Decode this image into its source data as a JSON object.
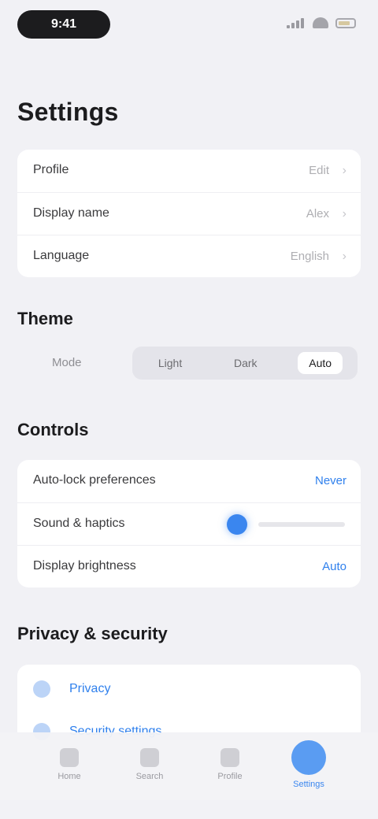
{
  "status_bar": {
    "time": "9:41"
  },
  "page": {
    "title": "Settings"
  },
  "account": {
    "rows": [
      {
        "label": "Profile",
        "value": "Edit"
      },
      {
        "label": "Display name",
        "value": "Alex"
      },
      {
        "label": "Language",
        "value": "English"
      }
    ]
  },
  "theme": {
    "title": "Theme",
    "label": "Mode",
    "options": [
      "Light",
      "Dark",
      "Auto"
    ],
    "selected": "Auto"
  },
  "controls": {
    "title": "Controls",
    "rows": [
      {
        "label": "Auto-lock preferences",
        "value": "Never"
      },
      {
        "label": "Sound & haptics",
        "level": 0.0
      },
      {
        "label": "Display brightness",
        "value": "Auto"
      }
    ]
  },
  "support": {
    "title": "Privacy & security",
    "links": [
      {
        "label": "Privacy"
      },
      {
        "label": "Security settings"
      }
    ]
  },
  "tabs": [
    {
      "label": "Home",
      "icon": "home-icon"
    },
    {
      "label": "Search",
      "icon": "search-icon"
    },
    {
      "label": "Profile",
      "icon": "person-icon"
    },
    {
      "label": "Settings",
      "icon": "gear-icon",
      "active": true
    }
  ]
}
